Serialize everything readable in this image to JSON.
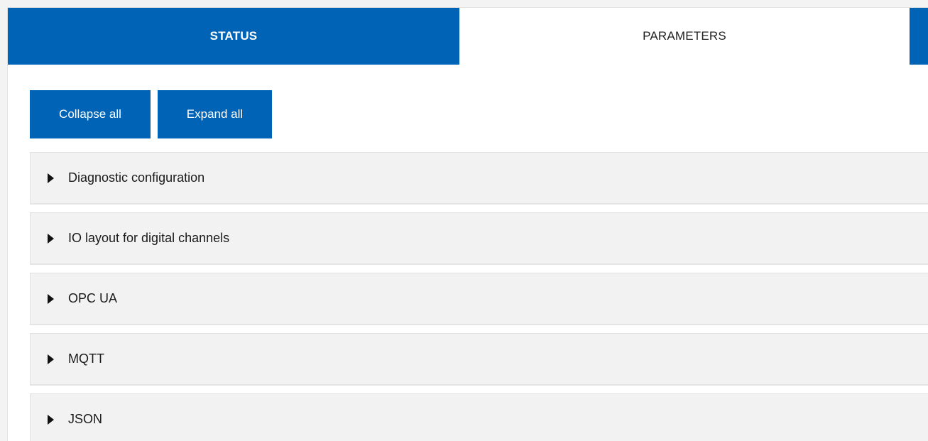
{
  "tabs": {
    "status": "STATUS",
    "parameters": "PARAMETERS"
  },
  "toolbar": {
    "collapse_label": "Collapse all",
    "expand_label": "Expand all"
  },
  "sections": [
    {
      "label": "Diagnostic configuration",
      "state": "collapsed"
    },
    {
      "label": "IO layout for digital channels",
      "state": "collapsed"
    },
    {
      "label": "OPC UA",
      "state": "collapsed"
    },
    {
      "label": "MQTT",
      "state": "collapsed"
    },
    {
      "label": "JSON",
      "state": "collapsed"
    }
  ],
  "colors": {
    "accent": "#0063b5",
    "section_background": "#f2f2f2",
    "page_background": "#ffffff"
  },
  "icons": {
    "section_toggle": "caret-right-icon"
  }
}
